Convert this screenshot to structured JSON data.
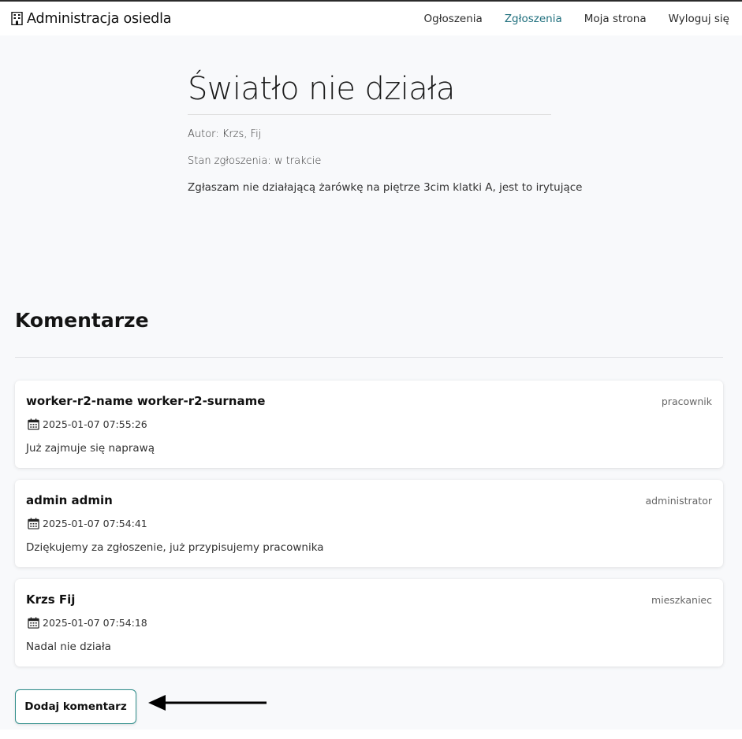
{
  "navbar": {
    "brand": "Administracja osiedla",
    "links": [
      {
        "label": "Ogłoszenia",
        "active": false
      },
      {
        "label": "Zgłoszenia",
        "active": true
      },
      {
        "label": "Moja strona",
        "active": false
      },
      {
        "label": "Wyloguj się",
        "active": false
      }
    ]
  },
  "ticket": {
    "title": "Światło nie działa",
    "author": "Autor: Krzs, Fij",
    "status": "Stan zgłoszenia: w trakcie",
    "description": "Zgłaszam nie działającą żarówkę na piętrze 3cim klatki A, jest to irytujące"
  },
  "comments": {
    "heading": "Komentarze",
    "items": [
      {
        "author": "worker-r2-name worker-r2-surname",
        "role": "pracownik",
        "date": "2025-01-07 07:55:26",
        "text": "Już zajmuje się naprawą"
      },
      {
        "author": "admin admin",
        "role": "administrator",
        "date": "2025-01-07 07:54:41",
        "text": "Dziękujemy za zgłoszenie, już przypisujemy pracownika"
      },
      {
        "author": "Krzs Fij",
        "role": "mieszkaniec",
        "date": "2025-01-07 07:54:18",
        "text": "Nadal nie działa"
      }
    ]
  },
  "actions": {
    "add_comment": "Dodaj komentarz"
  },
  "colors": {
    "accent": "#1f6f7d",
    "button_border": "#2e8d8a",
    "background": "#f8f9fb"
  },
  "icons": {
    "brand": "building-icon",
    "date": "calendar-icon",
    "annotation": "arrow-left-icon"
  }
}
